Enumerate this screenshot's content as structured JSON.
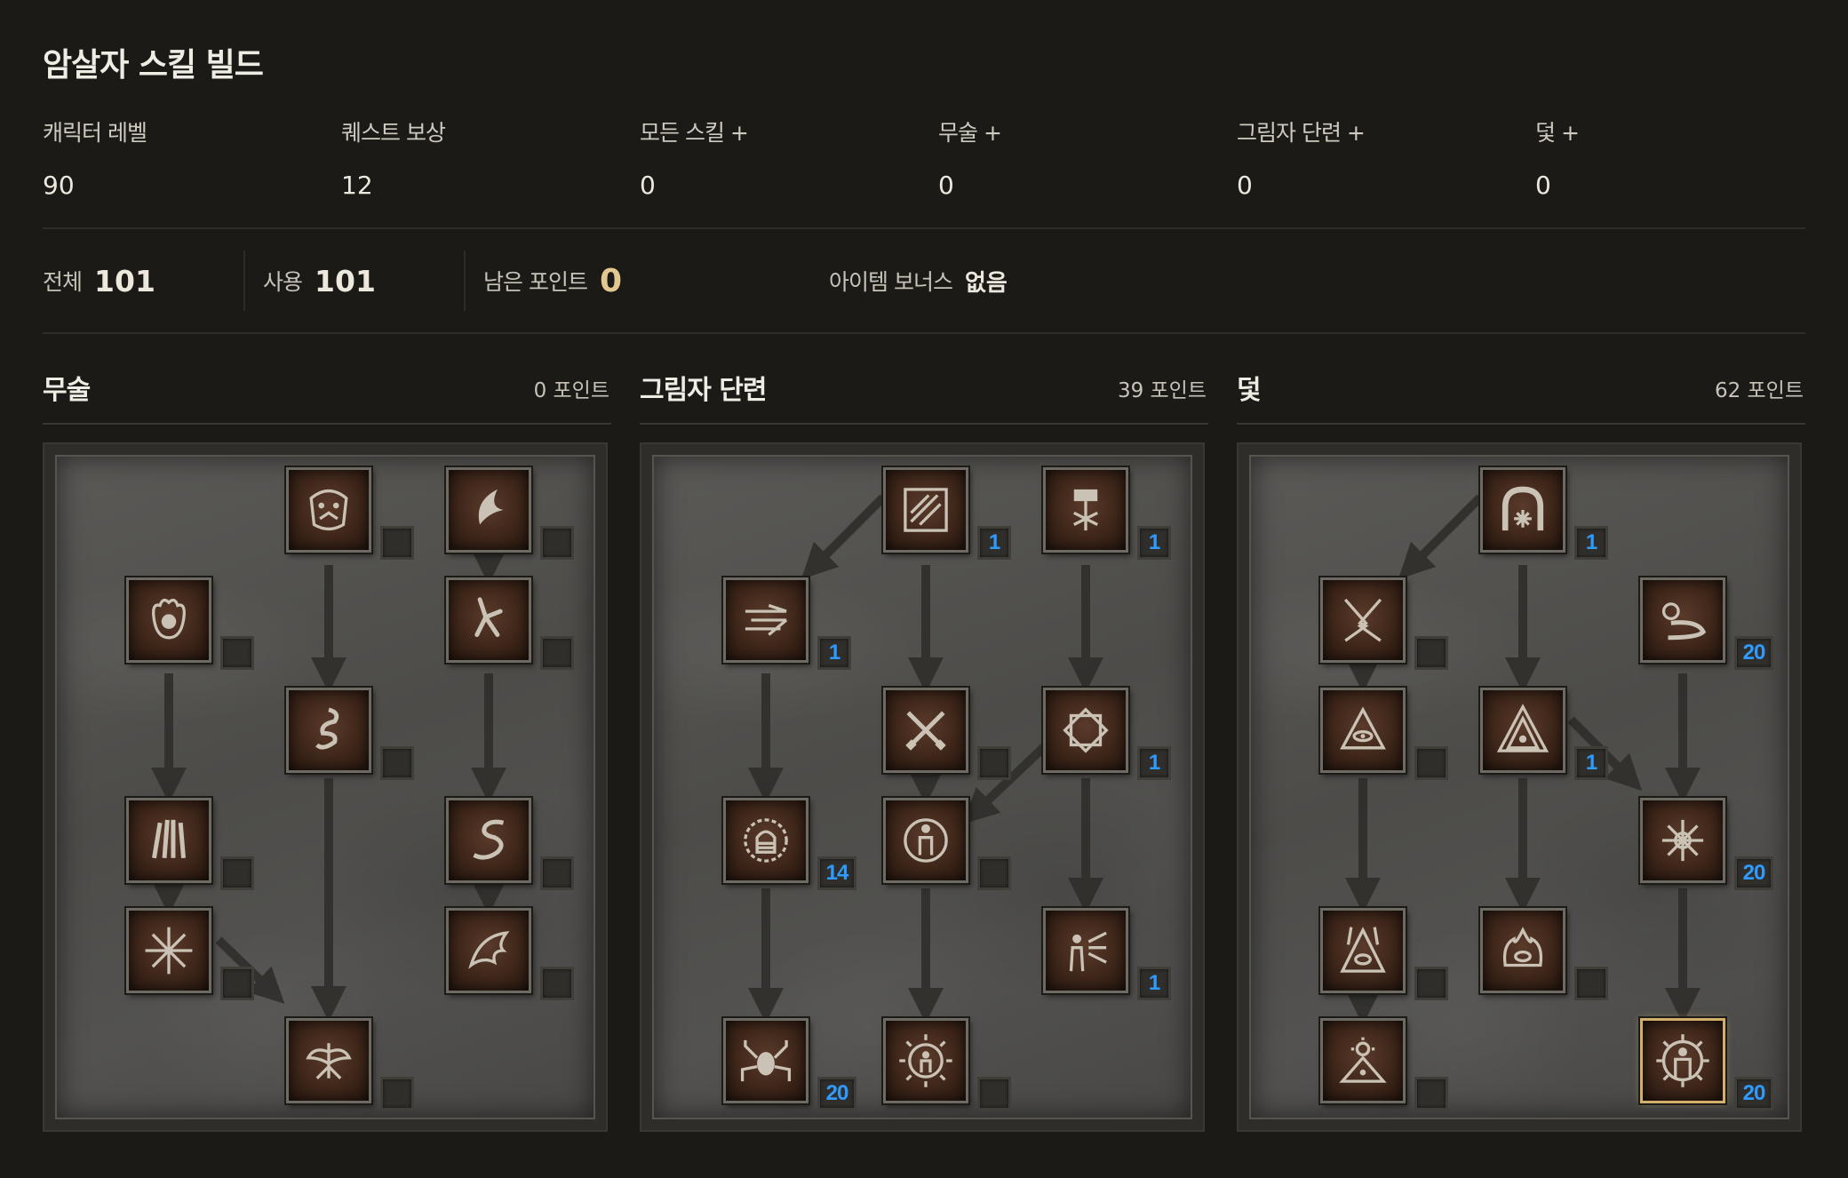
{
  "title": "암살자 스킬 빌드",
  "stats": [
    {
      "label": "캐릭터 레벨",
      "value": "90"
    },
    {
      "label": "퀘스트 보상",
      "value": "12"
    },
    {
      "label": "모든 스킬 +",
      "value": "0"
    },
    {
      "label": "무술 +",
      "value": "0"
    },
    {
      "label": "그림자 단련 +",
      "value": "0"
    },
    {
      "label": "덫 +",
      "value": "0"
    }
  ],
  "summary": {
    "total_label": "전체",
    "total_value": "101",
    "used_label": "사용",
    "used_value": "101",
    "remaining_label": "남은 포인트",
    "remaining_value": "0",
    "bonus_label": "아이템 보너스",
    "bonus_value": "없음"
  },
  "accent_colors": {
    "points_badge": "#2f9bff",
    "remaining_points": "#e3c791",
    "selected_border": "#d2b06b"
  },
  "trees": [
    {
      "name": "무술",
      "points": "0 포인트",
      "skills": [
        {
          "icon": "tiger-claw-icon",
          "points": ""
        },
        {
          "icon": "crescent-blade-icon",
          "points": ""
        },
        {
          "icon": "fire-fist-icon",
          "points": ""
        },
        {
          "icon": "dragon-kick-icon",
          "points": ""
        },
        {
          "icon": "cobra-coil-icon",
          "points": ""
        },
        {
          "icon": "claw-strike-icon",
          "points": ""
        },
        {
          "icon": "serpent-icon",
          "points": ""
        },
        {
          "icon": "starburst-icon",
          "points": ""
        },
        {
          "icon": "dragon-wing-icon",
          "points": ""
        },
        {
          "icon": "phoenix-icon",
          "points": ""
        }
      ]
    },
    {
      "name": "그림자 단련",
      "points": "39 포인트",
      "skills": [
        {
          "icon": "claw-mastery-icon",
          "points": "1"
        },
        {
          "icon": "hammer-burst-icon",
          "points": "1"
        },
        {
          "icon": "blade-dash-icon",
          "points": "1"
        },
        {
          "icon": "crossed-blades-icon",
          "points": ""
        },
        {
          "icon": "octagram-icon",
          "points": "1"
        },
        {
          "icon": "fist-spiral-icon",
          "points": "14"
        },
        {
          "icon": "figure-aura-icon",
          "points": ""
        },
        {
          "icon": "dash-figure-icon",
          "points": "1"
        },
        {
          "icon": "spider-icon",
          "points": "20"
        },
        {
          "icon": "glowing-figure-icon",
          "points": ""
        }
      ]
    },
    {
      "name": "덫",
      "points": "62 포인트",
      "skills": [
        {
          "icon": "arc-burst-icon",
          "points": "1"
        },
        {
          "icon": "lightning-cross-icon",
          "points": ""
        },
        {
          "icon": "spiral-wave-icon",
          "points": "20"
        },
        {
          "icon": "eye-pyramid-icon",
          "points": ""
        },
        {
          "icon": "fire-pyramid-icon",
          "points": "1"
        },
        {
          "icon": "blade-storm-icon",
          "points": "20"
        },
        {
          "icon": "lightning-eye-icon",
          "points": ""
        },
        {
          "icon": "flame-eye-icon",
          "points": ""
        },
        {
          "icon": "sun-eye-icon",
          "points": ""
        },
        {
          "icon": "shadow-figure-icon",
          "points": "20"
        }
      ]
    }
  ]
}
